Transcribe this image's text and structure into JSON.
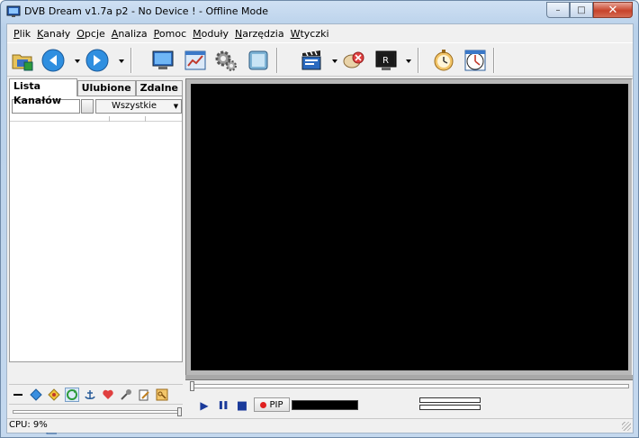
{
  "window": {
    "title": "DVB Dream v1.7a p2 - No Device ! - Offline Mode",
    "minimize_glyph": "–",
    "maximize_glyph": "□",
    "close_glyph": "✕"
  },
  "menu": [
    {
      "label": "Plik"
    },
    {
      "label": "Kanały"
    },
    {
      "label": "Opcje"
    },
    {
      "label": "Analiza"
    },
    {
      "label": "Pomoc"
    },
    {
      "label": "Moduły"
    },
    {
      "label": "Narzędzia"
    },
    {
      "label": "Wtyczki"
    }
  ],
  "toolbar": {
    "icons": [
      "open-folder-icon",
      "back-icon",
      "forward-icon",
      "monitor-icon",
      "chart-window-icon",
      "settings-gears-icon",
      "screen-glass-icon",
      "clapperboard-icon",
      "scan-cancel-icon",
      "record-screen-icon",
      "stopwatch-icon",
      "scheduler-clock-icon"
    ]
  },
  "left_panel": {
    "tabs": [
      {
        "label": "Lista Kanałów",
        "active": true
      },
      {
        "label": "Ulubione",
        "active": false
      },
      {
        "label": "Zdalne",
        "active": false
      }
    ],
    "filter": {
      "input_value": "",
      "select_value": "Wszystkie"
    },
    "channels": [],
    "icon_row": [
      "minus-icon",
      "diamond-blue-icon",
      "diamond-yellow-icon",
      "refresh-green-icon",
      "anchor-icon",
      "heart-icon",
      "tools-icon",
      "edit-doc-icon",
      "key-icon"
    ]
  },
  "controls": {
    "play_glyph": "▶",
    "pause_glyph": "❚❚",
    "stop_glyph": "■",
    "pip_label": "PIP"
  },
  "status": {
    "cpu": "CPU: 9%"
  }
}
